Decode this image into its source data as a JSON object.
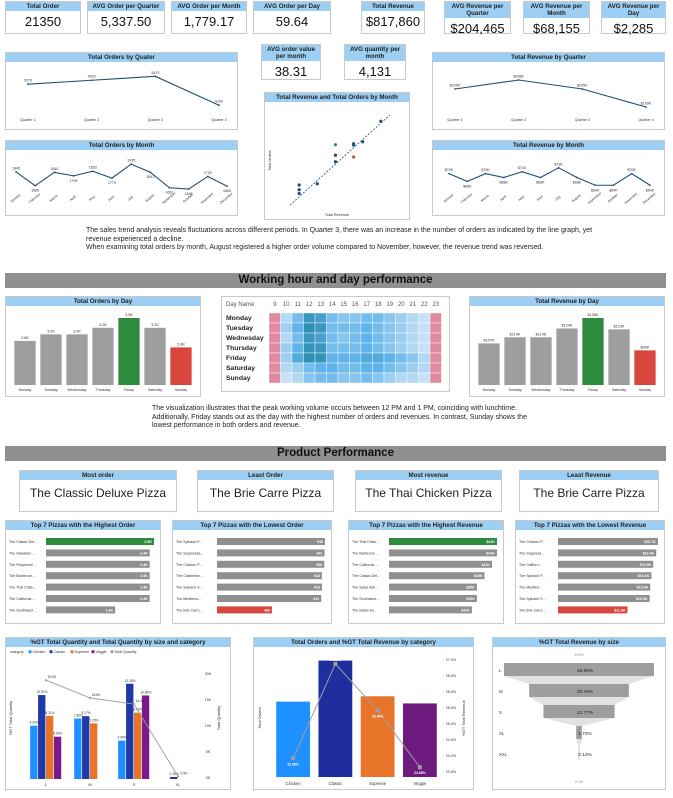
{
  "kpis": [
    {
      "label": "Total Order",
      "value": "21350"
    },
    {
      "label": "AVG Order per Quarter",
      "value": "5,337.50"
    },
    {
      "label": "AVG Order per Month",
      "value": "1,779.17"
    },
    {
      "label": "AVG Order per Day",
      "value": "59.64"
    },
    {
      "label": "Total Revenue",
      "value": "$817,860"
    },
    {
      "label": "AVG Revenue per Quarter",
      "value": "$204,465"
    },
    {
      "label": "AVG Revenue per Month",
      "value": "$68,155"
    },
    {
      "label": "AVG Revenue per Day",
      "value": "$2,285"
    }
  ],
  "kpis2": [
    {
      "label": "AVG order value per month",
      "value": "38.31"
    },
    {
      "label": "AVG quantity per month",
      "value": "4,131"
    }
  ],
  "sections": {
    "working": "Working hour and day performance",
    "product": "Product Performance"
  },
  "notes": {
    "sales_trend": "The sales trend analysis reveals fluctuations across different periods. In Quarter 3, there was an increase in the number of orders as indicated by the line graph, yet revenue experienced a decline.\nWhen examining total orders by month, August registered a higher order volume compared to November, however, the revenue trend was reversed.",
    "working": "The visualization illustrates that the peak working volume occurs between 12 PM and 1 PM, coinciding with lunchtime. Additionally, Friday stands out as the day with the highest number of orders and revenues. In contrast, Sunday shows the lowest performance in both orders and revenue."
  },
  "highlights": [
    {
      "label": "Most order",
      "value": "The Classic Deluxe Pizza"
    },
    {
      "label": "Least Order",
      "value": "The Brie Carre Pizza"
    },
    {
      "label": "Most revenue",
      "value": "The Thai Chicken Pizza"
    },
    {
      "label": "Least Revenue",
      "value": "The Brie Carre Pizza"
    }
  ],
  "heatmap": {
    "corner": "Day Name",
    "hours": [
      "9",
      "10",
      "11",
      "12",
      "13",
      "14",
      "15",
      "16",
      "17",
      "18",
      "19",
      "20",
      "21",
      "22",
      "23"
    ],
    "days": [
      "Monday",
      "Tuesday",
      "Wednesday",
      "Thursday",
      "Friday",
      "Saturday",
      "Sunday"
    ],
    "colors": {
      "low": "#dcebf8",
      "mid": "#5eb3ea",
      "high": "#2e8fb1",
      "edge": "#e08aa1"
    }
  },
  "chart_data": [
    {
      "id": "orders_quarter",
      "type": "line",
      "title": "Total Orders by Quater",
      "categories": [
        "Quarter 1",
        "Quarter 2",
        "Quarter 3",
        "Quarter 4"
      ],
      "values": [
        5370,
        5420,
        5470,
        5100
      ],
      "labels": [
        "5370",
        "5420",
        "5470",
        "5100"
      ]
    },
    {
      "id": "revenue_quarter",
      "type": "line",
      "title": "Total Revenue by Quarter",
      "categories": [
        "Quarter 1",
        "Quarter 2",
        "Quarter 3",
        "Quarter 4"
      ],
      "values": [
        205,
        208,
        205,
        199
      ],
      "labels": [
        "$205K",
        "$208K",
        "$205K",
        "$199K"
      ]
    },
    {
      "id": "orders_month",
      "type": "line",
      "title": "Total Orders by Month",
      "categories": [
        "January",
        "February",
        "March",
        "April",
        "May",
        "June",
        "July",
        "August",
        "September",
        "October",
        "November",
        "December"
      ],
      "values": [
        1845,
        1685,
        1840,
        1799,
        1853,
        1773,
        1935,
        1841,
        1661,
        1646,
        1792,
        1680
      ],
      "labels": [
        "1845",
        "1685",
        "1840",
        "1799",
        "1853",
        "1773",
        "1935",
        "1841",
        "1661",
        "1646",
        "1792",
        "1680"
      ]
    },
    {
      "id": "revenue_month",
      "type": "line",
      "title": "Total Revenue by Month",
      "categories": [
        "January",
        "February",
        "March",
        "April",
        "May",
        "June",
        "July",
        "August",
        "September",
        "October",
        "November",
        "December"
      ],
      "values": [
        70,
        66,
        70,
        68,
        71,
        68,
        73,
        68,
        64,
        64,
        70,
        64
      ],
      "labels": [
        "$70K",
        "$66K",
        "$70K",
        "$68K",
        "$71K",
        "$68K",
        "$73K",
        "$68K",
        "$64K",
        "$64K",
        "$70K",
        "$64K"
      ]
    },
    {
      "id": "scatter_rev_orders",
      "type": "scatter",
      "title": "Total Revenue and Total Orders by Month",
      "xlabel": "Total Revenue",
      "ylabel": "Total Orders",
      "x": [
        64,
        64,
        64,
        66,
        68,
        68,
        68,
        70,
        70,
        70,
        71,
        73
      ],
      "y": [
        1646,
        1661,
        1680,
        1685,
        1773,
        1799,
        1841,
        1845,
        1792,
        1840,
        1853,
        1935
      ],
      "point_colors": [
        "#1f4e79",
        "#1f4e79",
        "#1f4e79",
        "#1f4e79",
        "#1f4e79",
        "#1f4e79",
        "#2f9a47",
        "#1f4e79",
        "#d9463e",
        "#1f4e79",
        "#1f4e79",
        "#1f4e79"
      ]
    },
    {
      "id": "orders_day",
      "type": "bar",
      "title": "Total Orders by Day",
      "categories": [
        "Monday",
        "Tuesday",
        "Wednesday",
        "Thursday",
        "Friday",
        "Saturday",
        "Sunday"
      ],
      "values": [
        2.8,
        3.0,
        3.0,
        3.2,
        3.5,
        3.2,
        2.6
      ],
      "labels": [
        "2.8K",
        "3.0K",
        "3.0K",
        "3.2K",
        "3.5K",
        "3.2K",
        "2.6K"
      ],
      "bar_colors": [
        "#9e9e9e",
        "#9e9e9e",
        "#9e9e9e",
        "#9e9e9e",
        "#2e8b3d",
        "#9e9e9e",
        "#d9463e"
      ]
    },
    {
      "id": "revenue_day",
      "type": "bar",
      "title": "Total Revenue by Day",
      "categories": [
        "Monday",
        "Tuesday",
        "Wednesday",
        "Thursday",
        "Friday",
        "Saturday",
        "Sunday"
      ],
      "values": [
        107,
        114,
        114,
        124,
        136,
        123,
        99
      ],
      "labels": [
        "$107K",
        "$114K",
        "$114K",
        "$124K",
        "$136K",
        "$123K",
        "$99K"
      ],
      "bar_colors": [
        "#9e9e9e",
        "#9e9e9e",
        "#9e9e9e",
        "#9e9e9e",
        "#2e8b3d",
        "#9e9e9e",
        "#d9463e"
      ]
    },
    {
      "id": "top_orders",
      "type": "bar",
      "title": "Top 7 Pizzas with the Highest Order",
      "categories": [
        "The Classic Del...",
        "The Hawaiian ...",
        "The Pepperoni ...",
        "The Barbecue ...",
        "The Thai Chick...",
        "The California ...",
        "The Southwest ..."
      ],
      "values": [
        2.5,
        2.4,
        2.4,
        2.4,
        2.4,
        2.4,
        1.6
      ],
      "labels": [
        "2.5K",
        "2.4K",
        "2.4K",
        "2.4K",
        "2.4K",
        "2.4K",
        "1.6K"
      ],
      "bar_colors": [
        "#2e8b3d",
        "#8f8f8f",
        "#8f8f8f",
        "#8f8f8f",
        "#8f8f8f",
        "#8f8f8f",
        "#8f8f8f"
      ]
    },
    {
      "id": "low_orders",
      "type": "bar",
      "title": "Top 7 Pizzas with the Lowest Order",
      "categories": [
        "The Spinach P...",
        "The Soppressa...",
        "The Chicken P...",
        "The Calabrese ...",
        "The Spinach S...",
        "The Mediterra...",
        "The Brie Carre ..."
      ],
      "values": [
        945,
        941,
        938,
        918,
        918,
        912,
        480
      ],
      "labels": [
        "945",
        "941",
        "938",
        "918",
        "918",
        "912",
        "480"
      ],
      "bar_colors": [
        "#8f8f8f",
        "#8f8f8f",
        "#8f8f8f",
        "#8f8f8f",
        "#8f8f8f",
        "#8f8f8f",
        "#d9463e"
      ]
    },
    {
      "id": "top_revenue",
      "type": "bar",
      "title": "Top 7 Pizzas with the Highest Revenue",
      "categories": [
        "The Thai Chick...",
        "The Barbecue ...",
        "The California ...",
        "The Classic Del...",
        "The Spicy Itali...",
        "The Southwest...",
        "The Italian Su..."
      ],
      "values": [
        43,
        43,
        41,
        38,
        35,
        35,
        33
      ],
      "labels": [
        "$43K",
        "$43K",
        "$41K",
        "$38K",
        "$35K",
        "$35K",
        "$33K"
      ],
      "bar_colors": [
        "#2e8b3d",
        "#8f8f8f",
        "#8f8f8f",
        "#8f8f8f",
        "#8f8f8f",
        "#8f8f8f",
        "#8f8f8f"
      ]
    },
    {
      "id": "low_revenue",
      "type": "bar",
      "title": "Top 7 Pizzas with the Lowest Revenue",
      "categories": [
        "The Chicken P...",
        "The Soppress...",
        "The Californ...",
        "The Spinach P...",
        "The Mediterr...",
        "The Spinach S...",
        "The Brie Carre ..."
      ],
      "values": [
        16.7,
        16.4,
        15.9,
        15.6,
        15.4,
        15.3,
        11.6
      ],
      "labels": [
        "$16.7K",
        "$16.4K",
        "$15.9K",
        "$15.6K",
        "$15.4K",
        "$15.3K",
        "$11.6K"
      ],
      "bar_colors": [
        "#8f8f8f",
        "#8f8f8f",
        "#8f8f8f",
        "#8f8f8f",
        "#8f8f8f",
        "#8f8f8f",
        "#d9463e"
      ]
    },
    {
      "id": "gt_quantity_size_cat",
      "type": "bar",
      "title": "%GT Total Quantity and Total Quantity by size and category",
      "legend_title": "category",
      "categories": [
        "L",
        "M",
        "S",
        "XL"
      ],
      "series": [
        {
          "name": "Chicken",
          "color": "#1e90ff",
          "values": [
            6.93,
            7.86,
            4.99,
            0
          ]
        },
        {
          "name": "Classic",
          "color": "#1f3aa8",
          "values": [
            10.91,
            8.17,
            12.38,
            0.26
          ]
        },
        {
          "name": "Supreme",
          "color": "#e8742a",
          "values": [
            8.21,
            7.23,
            8.62,
            0
          ]
        },
        {
          "name": "Veggie",
          "color": "#7a1a8c",
          "values": [
            5.5,
            0,
            10.86,
            0
          ]
        }
      ],
      "labels": [
        "6.93%",
        "10.91%",
        "8.21%",
        "5.50%",
        "7.86%",
        "8.17%",
        "7.23%",
        "4.99%",
        "12.38%",
        "8.62%",
        "10.86%",
        "0.26%"
      ],
      "line_series": {
        "name": "Total Quantity",
        "color": "#9e9e9e",
        "values": [
          19000,
          15600,
          14400,
          500
        ]
      },
      "line_labels": [
        "19.0K",
        "15.6K",
        "14.4K",
        "0.5K"
      ],
      "ylabel": "%GT Total Quantity",
      "y2label": "Total Quantity",
      "y2ticks": [
        "20K",
        "15K",
        "10K",
        "5K",
        "0K"
      ]
    },
    {
      "id": "orders_gt_rev_category",
      "type": "bar",
      "title": "Total Orders and %GT Total Revenue by category",
      "categories": [
        "Chicken",
        "Classic",
        "Supreme",
        "Veggie"
      ],
      "values": [
        4050,
        5200,
        4200,
        4000
      ],
      "bar_colors": [
        "#1e90ff",
        "#1f2e9e",
        "#e8742a",
        "#6e1b80"
      ],
      "line_series": {
        "name": "%GT Total Revenue",
        "values": [
          23.96,
          26.91,
          25.46,
          23.68
        ]
      },
      "line_labels": [
        "23.96%",
        "26.91%",
        "25.46%",
        "23.68%"
      ],
      "ylabel": "Total Orders",
      "y2label": "%GT Total Revenue",
      "y2ticks": [
        "27.0%",
        "26.5%",
        "26.0%",
        "25.5%",
        "25.0%",
        "24.5%",
        "24.0%",
        "23.5%"
      ]
    },
    {
      "id": "gt_revenue_size",
      "type": "bar",
      "title": "%GT Total Revenue by size",
      "categories": [
        "L",
        "M",
        "S",
        "XL",
        "XXL"
      ],
      "values": [
        45.89,
        30.49,
        21.77,
        1.72,
        0.12
      ],
      "labels": [
        "45.89%",
        "30.49%",
        "21.77%",
        "1.72%",
        "0.12%"
      ],
      "axis_top": "100%",
      "axis_bottom": "0.1%"
    }
  ]
}
